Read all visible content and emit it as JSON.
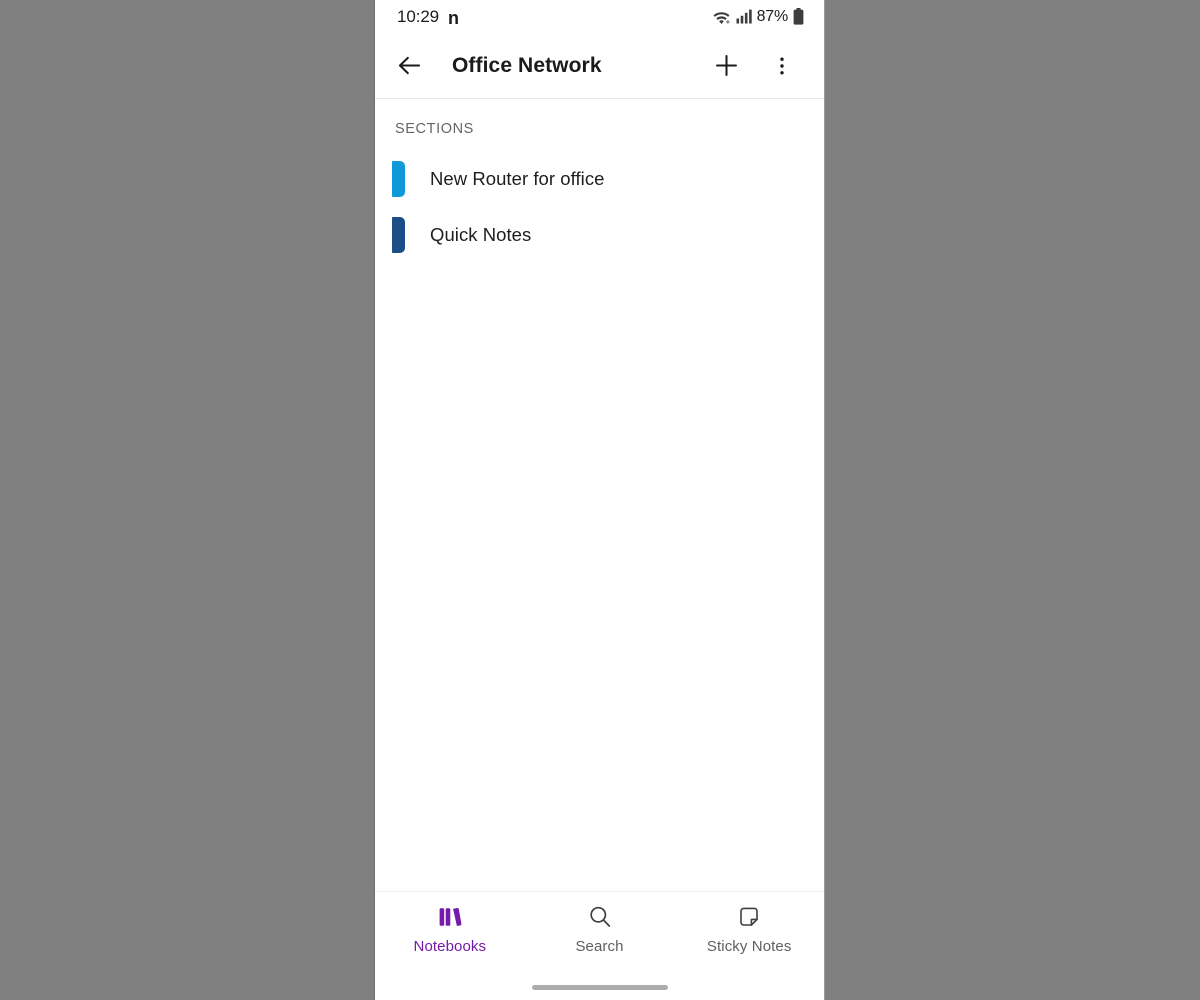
{
  "status_bar": {
    "time": "10:29",
    "notification_glyph": "n",
    "wifi_icon": "wifi-icon",
    "signal_icon": "cellular-signal-icon",
    "battery_percent": "87%",
    "battery_icon": "battery-icon"
  },
  "app_bar": {
    "back_icon": "back-arrow-icon",
    "title": "Office Network",
    "add_icon": "plus-icon",
    "overflow_icon": "more-vertical-icon"
  },
  "content": {
    "sections_header": "SECTIONS",
    "sections": [
      {
        "label": "New Router for office",
        "color": "#0e9ad8"
      },
      {
        "label": "Quick Notes",
        "color": "#1b4e87"
      }
    ]
  },
  "bottom_nav": {
    "active_color": "#7719aa",
    "inactive_color": "#5f5f5f",
    "items": [
      {
        "label": "Notebooks",
        "icon": "notebooks-icon",
        "active": true
      },
      {
        "label": "Search",
        "icon": "search-icon",
        "active": false
      },
      {
        "label": "Sticky Notes",
        "icon": "sticky-notes-icon",
        "active": false
      }
    ]
  }
}
